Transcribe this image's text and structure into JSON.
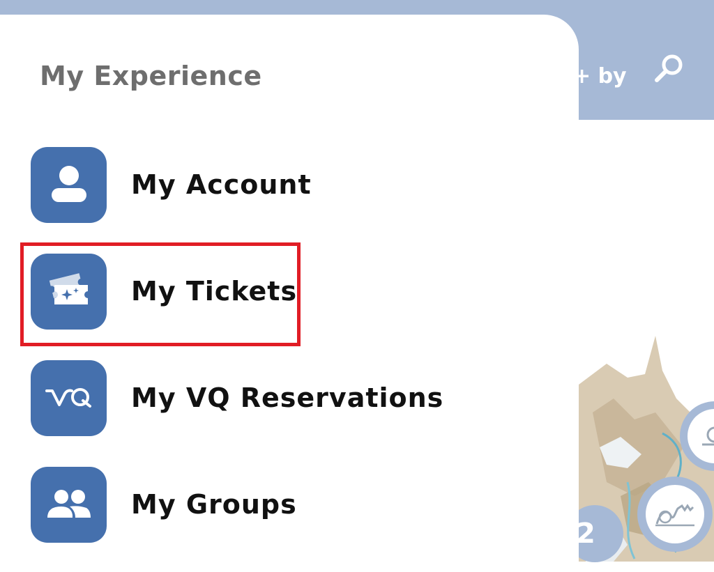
{
  "background": {
    "header_text": "+ by",
    "search_icon": "search-icon",
    "cluster_count": "2",
    "top_bar_color": "#a6b9d6"
  },
  "drawer": {
    "title": "My Experience",
    "items": [
      {
        "label": "My Account",
        "icon": "account-icon"
      },
      {
        "label": "My Tickets",
        "icon": "tickets-icon"
      },
      {
        "label": "My VQ Reservations",
        "icon": "vq-icon"
      },
      {
        "label": "My Groups",
        "icon": "groups-icon"
      }
    ],
    "highlighted_item": "My Tickets",
    "icon_color": "#4570ad",
    "highlight_color": "#e11d25"
  }
}
